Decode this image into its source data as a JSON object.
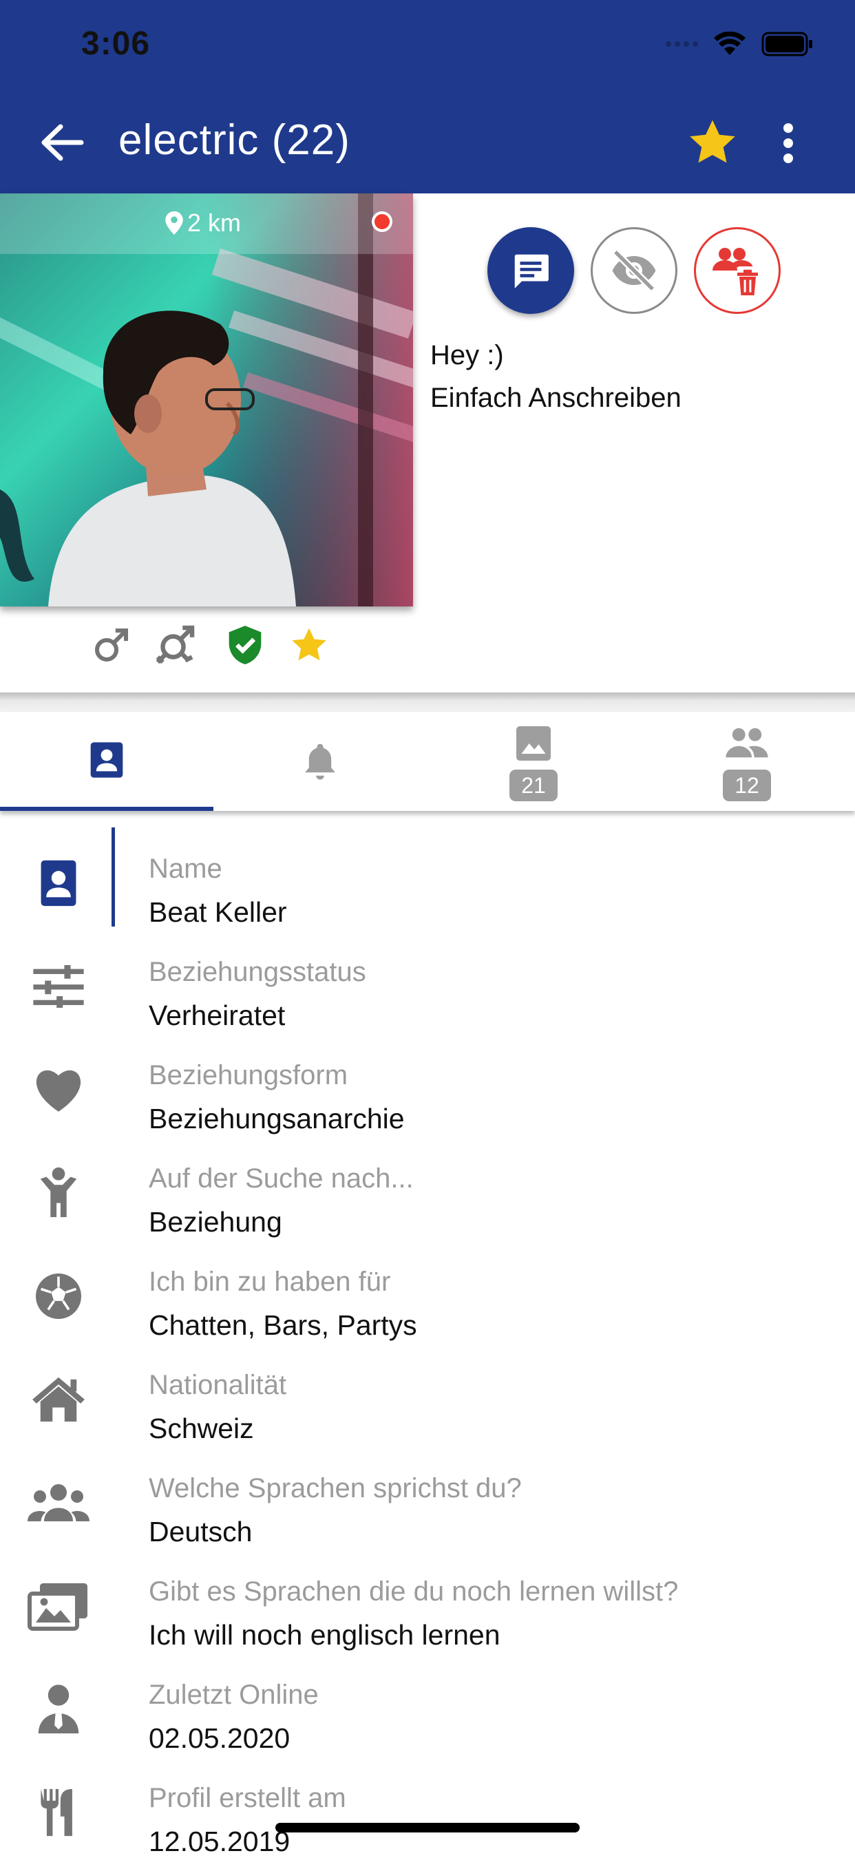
{
  "status_bar": {
    "time": "3:06"
  },
  "header": {
    "title": "electric (22)"
  },
  "photo": {
    "distance": "2 km"
  },
  "status_message": {
    "line1": "Hey :)",
    "line2": "Einfach Anschreiben"
  },
  "tabs": {
    "images_count": "21",
    "friends_count": "12"
  },
  "colors": {
    "primary": "#1f3a8c",
    "danger": "#e53935",
    "star": "#f5c518",
    "verified": "#1a8a2a",
    "muted": "#9b9b9b"
  },
  "details": [
    {
      "icon": "contact-card-icon",
      "label": "Name",
      "value": "Beat Keller"
    },
    {
      "icon": "sliders-icon",
      "label": "Beziehungsstatus",
      "value": "Verheiratet"
    },
    {
      "icon": "heart-icon",
      "label": "Beziehungsform",
      "value": "Beziehungsanarchie"
    },
    {
      "icon": "child-icon",
      "label": "Auf der Suche nach...",
      "value": "Beziehung"
    },
    {
      "icon": "soccer-ball-icon",
      "label": "Ich bin zu haben für",
      "value": "Chatten, Bars, Partys"
    },
    {
      "icon": "home-icon",
      "label": "Nationalität",
      "value": "Schweiz"
    },
    {
      "icon": "group-icon",
      "label": "Welche Sprachen sprichst du?",
      "value": "Deutsch"
    },
    {
      "icon": "photos-icon",
      "label": "Gibt es Sprachen die du noch lernen willst?",
      "value": "Ich will noch englisch lernen"
    },
    {
      "icon": "businessman-icon",
      "label": "Zuletzt Online",
      "value": "02.05.2020"
    },
    {
      "icon": "fork-knife-icon",
      "label": "Profil erstellt am",
      "value": "12.05.2019"
    }
  ]
}
